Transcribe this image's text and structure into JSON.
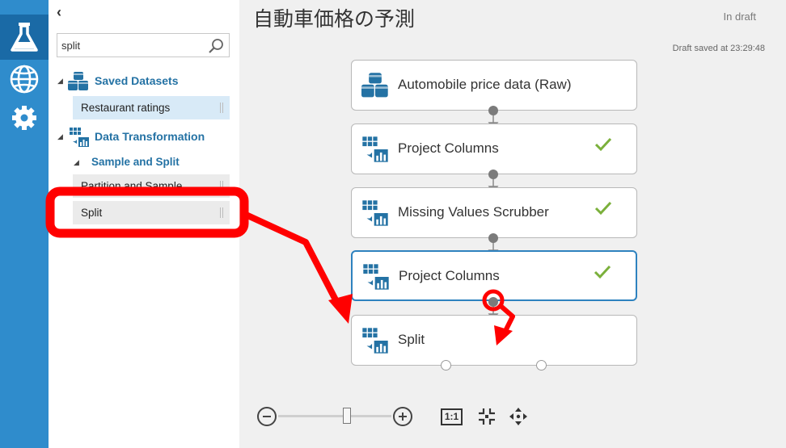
{
  "colors": {
    "rail": "#2f8ccc",
    "rail_active": "#1a6aa6",
    "accent": "#2e82bf",
    "check": "#7bb03b",
    "annotation": "#ff0000"
  },
  "rail": [
    {
      "icon": "flask-icon",
      "active": true
    },
    {
      "icon": "globe-icon",
      "active": false
    },
    {
      "icon": "gear-icon",
      "active": false
    }
  ],
  "palette": {
    "collapse_glyph": "‹",
    "search": {
      "value": "split",
      "icon": "search-icon"
    },
    "categories": [
      {
        "label": "Saved Datasets",
        "icon": "dataset-icon",
        "items": [
          "Restaurant ratings"
        ]
      },
      {
        "label": "Data Transformation",
        "icon": "transform-icon",
        "subcategories": [
          {
            "label": "Sample and Split",
            "items": [
              "Partition and Sample",
              "Split"
            ]
          }
        ]
      }
    ]
  },
  "canvas": {
    "title": "自動車価格の予測",
    "status": "In draft",
    "saved_text": "Draft saved at 23:29:48",
    "modules": [
      {
        "label": "Automobile price data (Raw)",
        "icon": "dataset-icon",
        "status": "none",
        "selected": false
      },
      {
        "label": "Project Columns",
        "icon": "transform-icon",
        "status": "check-icon",
        "selected": false
      },
      {
        "label": "Missing Values Scrubber",
        "icon": "transform-icon",
        "status": "check-icon",
        "selected": false
      },
      {
        "label": "Project Columns",
        "icon": "transform-icon",
        "status": "check-icon",
        "selected": true
      },
      {
        "label": "Split",
        "icon": "transform-icon",
        "status": "none",
        "selected": false
      }
    ]
  },
  "zoom_toolbar": {
    "zoom_out": "zoom-out-icon",
    "zoom_in": "zoom-in-icon",
    "actual_size_label": "1:1",
    "fit": "fit-to-screen-icon",
    "pan": "pan-icon",
    "zoom_level": 0.5
  }
}
